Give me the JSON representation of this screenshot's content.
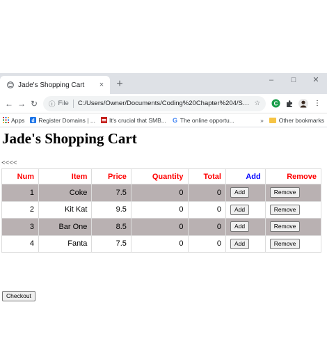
{
  "browser": {
    "tab_title": "Jade's Shopping Cart",
    "tab_close": "×",
    "new_tab": "+",
    "win_min": "–",
    "win_max": "□",
    "win_close": "✕",
    "file_label": "File",
    "url": "C:/Users/Owner/Documents/Coding%20Chapter%204/Sho...",
    "bookmarks": [
      {
        "label": "Apps"
      },
      {
        "label": "Register Domains | ..."
      },
      {
        "label": "It's crucial that SMB..."
      },
      {
        "label": "The online opportu..."
      }
    ],
    "bookmarks_more": "»",
    "other_bookmarks": "Other bookmarks"
  },
  "page": {
    "title": "Jade's Shopping Cart",
    "back_link": "<<<<",
    "checkout_label": "Checkout"
  },
  "table": {
    "headers": {
      "num": "Num",
      "item": "Item",
      "price": "Price",
      "quantity": "Quantity",
      "total": "Total",
      "add": "Add",
      "remove": "Remove"
    },
    "add_label": "Add",
    "remove_label": "Remove",
    "rows": [
      {
        "num": "1",
        "item": "Coke",
        "price": "7.5",
        "quantity": "0",
        "total": "0"
      },
      {
        "num": "2",
        "item": "Kit Kat",
        "price": "9.5",
        "quantity": "0",
        "total": "0"
      },
      {
        "num": "3",
        "item": "Bar One",
        "price": "8.5",
        "quantity": "0",
        "total": "0"
      },
      {
        "num": "4",
        "item": "Fanta",
        "price": "7.5",
        "quantity": "0",
        "total": "0"
      }
    ]
  },
  "colors": {
    "header_red": "#ff0000",
    "header_blue": "#0000ff",
    "row_shade": "#b9b1b2"
  }
}
